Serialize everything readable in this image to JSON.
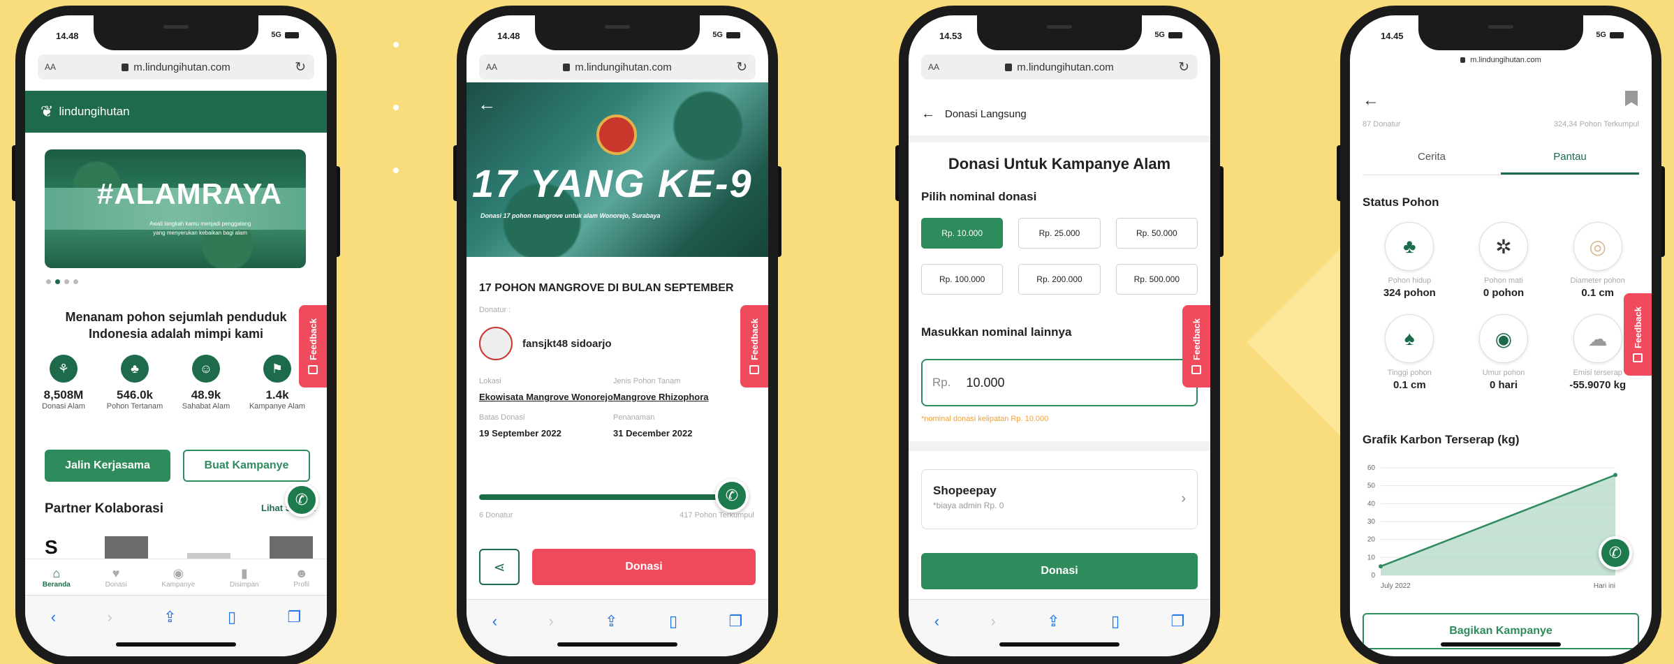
{
  "colors": {
    "background": "#f9dc7b",
    "brand_green": "#1d6b4a",
    "accent_green": "#2e8b5c",
    "feedback_red": "#ef4b5d",
    "link_blue": "#1a73e8"
  },
  "feedback_label": "Feedback",
  "phone1": {
    "status": {
      "time": "14.48",
      "signal": "5G"
    },
    "url": "m.lindungihutan.com",
    "url_aa": "AA",
    "brand": "lindungihutan",
    "banner": {
      "title": "#ALAMRAYA",
      "subtitle_line1": "Awali langkah kamu menjadi penggalang",
      "subtitle_line2": "yang menyerukan kebaikan bagi alam"
    },
    "mission": "Menanam pohon sejumlah penduduk Indonesia adalah mimpi kami",
    "stats": [
      {
        "icon": "seedling-icon",
        "value": "8,508M",
        "label": "Donasi Alam"
      },
      {
        "icon": "tree-icon",
        "value": "546.0k",
        "label": "Pohon Tertanam"
      },
      {
        "icon": "person-icon",
        "value": "48.9k",
        "label": "Sahabat Alam"
      },
      {
        "icon": "flag-icon",
        "value": "1.4k",
        "label": "Kampanye Alam"
      }
    ],
    "btn_collab": "Jalin Kerjasama",
    "btn_campaign": "Buat Kampanye",
    "partner_title": "Partner Kolaborasi",
    "partner_link": "Lihat Semua",
    "partner_logo_letter": "S",
    "nav": [
      {
        "icon": "home-icon",
        "label": "Beranda"
      },
      {
        "icon": "donate-icon",
        "label": "Donasi"
      },
      {
        "icon": "campaign-icon",
        "label": "Kampanye"
      },
      {
        "icon": "bookmark-icon",
        "label": "Disimpan"
      },
      {
        "icon": "profile-icon",
        "label": "Profil"
      }
    ]
  },
  "phone2": {
    "status": {
      "time": "14.48",
      "signal": "5G"
    },
    "url": "m.lindungihutan.com",
    "url_aa": "AA",
    "hero": {
      "title": "17 YANG KE-9",
      "subtitle": "Donasi 17 pohon mangrove untuk alam Wonorejo, Surabaya"
    },
    "campaign_title": "17 POHON MANGROVE DI BULAN SEPTEMBER",
    "donor_label": "Donatur :",
    "donor_name": "fansjkt48 sidoarjo",
    "fields": [
      {
        "label": "Lokasi",
        "value": "Ekowisata Mangrove Wonorejo"
      },
      {
        "label": "Jenis Pohon Tanam",
        "value": "Mangrove Rhizophora"
      },
      {
        "label": "Batas Donasi",
        "value": "19 September 2022"
      },
      {
        "label": "Penanaman",
        "value": "31 December 2022"
      }
    ],
    "progress": 1.0,
    "donors_count": "6 Donatur",
    "trees_collected": "417 Pohon Terkumpul",
    "donate_btn": "Donasi"
  },
  "phone3": {
    "status": {
      "time": "14.53",
      "signal": "5G"
    },
    "url": "m.lindungihutan.com",
    "url_aa": "AA",
    "header": "Donasi Langsung",
    "title": "Donasi Untuk Kampanye Alam",
    "choose_label": "Pilih nominal donasi",
    "options": [
      "Rp. 10.000",
      "Rp. 25.000",
      "Rp. 50.000",
      "Rp. 100.000",
      "Rp. 200.000",
      "Rp. 500.000"
    ],
    "selected_option": "Rp. 10.000",
    "other_label": "Masukkan nominal lainnya",
    "input": {
      "prefix": "Rp.",
      "value": "10.000"
    },
    "min_note": "*nominal donasi kelipatan Rp. 10.000",
    "payment": {
      "name": "Shopeepay",
      "note": "*biaya admin Rp. 0"
    },
    "donate_btn": "Donasi"
  },
  "phone4": {
    "status": {
      "time": "14.45",
      "signal": "5G"
    },
    "url": "m.lindungihutan.com",
    "counts_left": "87 Donatur",
    "counts_right": "324,34 Pohon Terkumpul",
    "tabs": [
      "Cerita",
      "Pantau"
    ],
    "active_tab": "Pantau",
    "status_title": "Status Pohon",
    "tree_status": [
      {
        "icon": "tree-icon",
        "label": "Pohon hidup",
        "value": "324 pohon"
      },
      {
        "icon": "dead-tree-icon",
        "label": "Pohon mati",
        "value": "0 pohon"
      },
      {
        "icon": "trunk-icon",
        "label": "Diameter pohon",
        "value": "0.1 cm"
      },
      {
        "icon": "tree-height-icon",
        "label": "Tinggi pohon",
        "value": "0.1 cm"
      },
      {
        "icon": "age-icon",
        "label": "Umur pohon",
        "value": "0 hari"
      },
      {
        "icon": "carbon-icon",
        "label": "Emisi terserap",
        "value": "-55.9070 kg"
      }
    ],
    "chart_title": "Grafik Karbon Terserap (kg)",
    "share_btn": "Bagikan Kampanye"
  },
  "chart_data": {
    "type": "area",
    "title": "Grafik Karbon Terserap (kg)",
    "x": [
      "July 2022",
      "Hari ini"
    ],
    "y_ticks": [
      0,
      10,
      20,
      30,
      40,
      50,
      60
    ],
    "series": [
      {
        "values": [
          5,
          56
        ]
      }
    ],
    "ylim": [
      0,
      60
    ],
    "grid": true
  }
}
